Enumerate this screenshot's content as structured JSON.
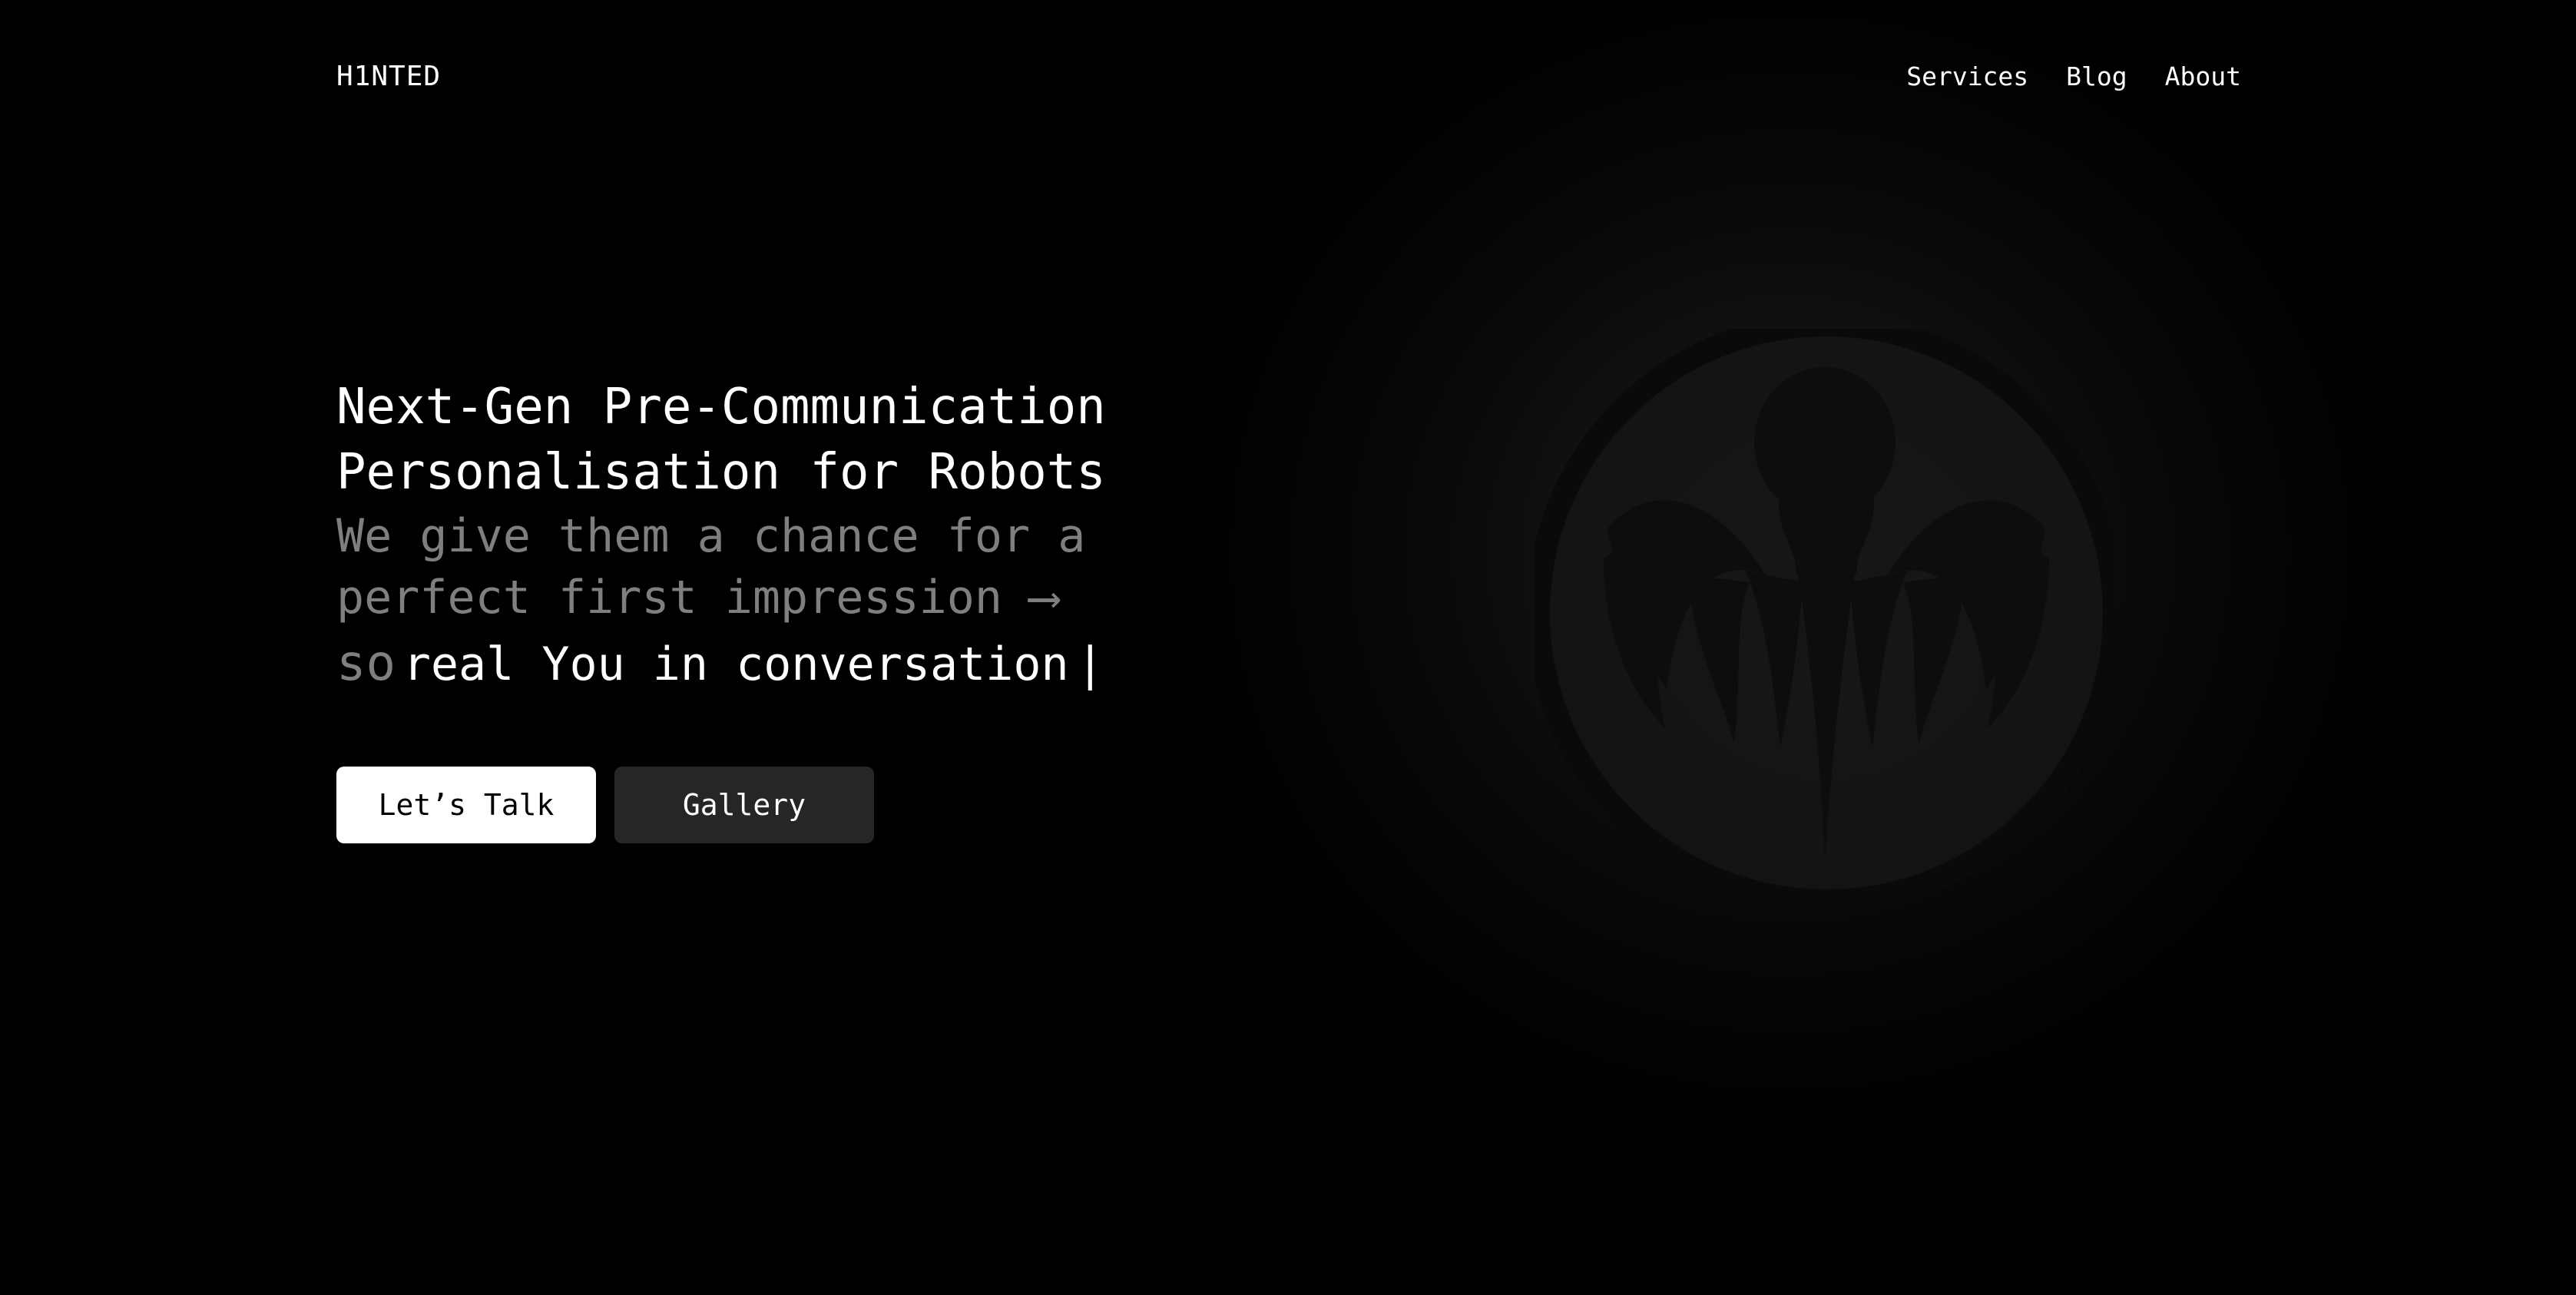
{
  "brand": {
    "logo": "H1NTED"
  },
  "nav": {
    "items": [
      {
        "label": "Services"
      },
      {
        "label": "Blog"
      },
      {
        "label": "About"
      }
    ]
  },
  "hero": {
    "headline_line1": "Next-Gen Pre-Communication",
    "headline_line2": "Personalisation for Robots",
    "sub_line1": "We give them a chance for a",
    "sub_line2": "perfect first impression ⟶",
    "typed_prefix": "so",
    "typed_text": "real You in conversation",
    "cursor": "|"
  },
  "actions": {
    "primary_label": "Let’s Talk",
    "secondary_label": "Gallery"
  },
  "background": {
    "emblem_icon": "octopus-emblem-icon"
  },
  "colors": {
    "background": "#000000",
    "text": "#ffffff",
    "muted_text": "#7f7f7f",
    "primary_button": "#ffffff",
    "secondary_button": "#262626"
  }
}
